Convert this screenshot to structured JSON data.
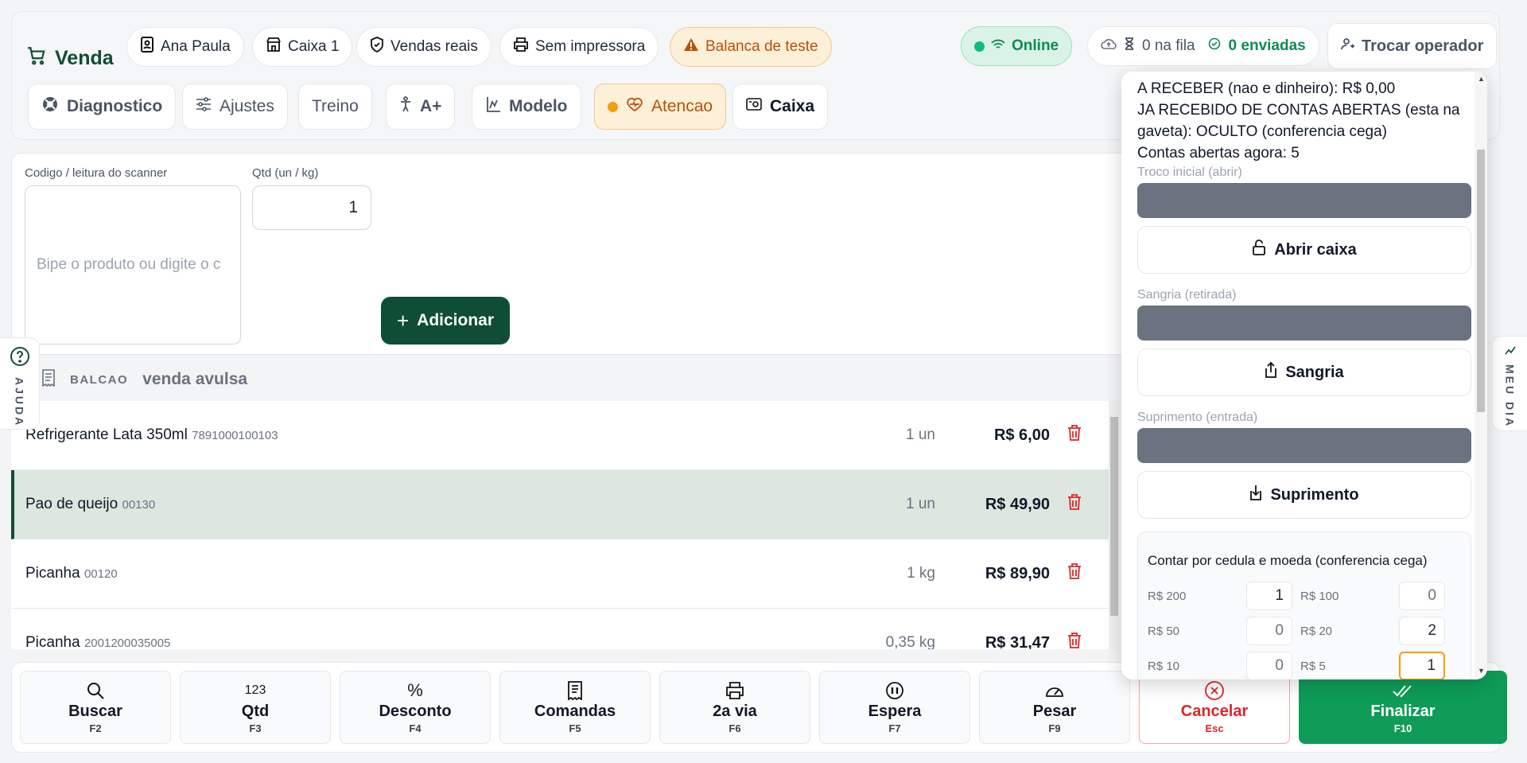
{
  "header": {
    "title": "Venda",
    "operator": "Ana Paula",
    "register": "Caixa 1",
    "mode": "Vendas reais",
    "printer": "Sem impressora",
    "scale": "Balanca de teste",
    "status": "Online",
    "queue": "0 na fila",
    "sent": "0 enviadas",
    "switch_operator": "Trocar operador"
  },
  "toolbar": {
    "diagnostics": "Diagnostico",
    "settings": "Ajustes",
    "training": "Treino",
    "font_size": "A+",
    "model": "Modelo",
    "attention": "Atencao",
    "cash": "Caixa"
  },
  "input": {
    "code_label": "Codigo / leitura do scanner",
    "code_placeholder": "Bipe o produto ou digite o c",
    "qty_label": "Qtd (un / kg)",
    "qty_value": "1",
    "add_button": "Adicionar"
  },
  "help": {
    "label": "AJUDA"
  },
  "right_tab": {
    "label": "MEU DIA"
  },
  "order": {
    "tag": "BALCAO",
    "subtitle": "venda avulsa",
    "items": [
      {
        "name": "Refrigerante Lata 350ml",
        "code": "7891000100103",
        "qty": "1 un",
        "price": "R$ 6,00"
      },
      {
        "name": "Pao de queijo",
        "code": "00130",
        "qty": "1 un",
        "price": "R$ 49,90"
      },
      {
        "name": "Picanha",
        "code": "00120",
        "qty": "1 kg",
        "price": "R$ 89,90"
      },
      {
        "name": "Picanha",
        "code": "2001200035005",
        "qty": "0,35 kg",
        "price": "R$ 31,47"
      }
    ]
  },
  "keys": [
    {
      "label": "Buscar",
      "shortcut": "F2"
    },
    {
      "label": "Qtd",
      "shortcut": "F3",
      "icon_text": "123"
    },
    {
      "label": "Desconto",
      "shortcut": "F4",
      "icon_text": "%"
    },
    {
      "label": "Comandas",
      "shortcut": "F5"
    },
    {
      "label": "2a via",
      "shortcut": "F6"
    },
    {
      "label": "Espera",
      "shortcut": "F7"
    },
    {
      "label": "Pesar",
      "shortcut": "F9"
    },
    {
      "label": "Cancelar",
      "shortcut": "Esc"
    },
    {
      "label": "Finalizar",
      "shortcut": "F10"
    }
  ],
  "cash_panel": {
    "receivable": "A RECEBER (nao e dinheiro): R$ 0,00",
    "received": "JA RECEBIDO DE CONTAS ABERTAS (esta na gaveta): OCULTO (conferencia cega)",
    "open_accounts": "Contas abertas agora: 5",
    "opening_label": "Troco inicial (abrir)",
    "open_button": "Abrir caixa",
    "withdraw_label": "Sangria (retirada)",
    "withdraw_button": "Sangria",
    "supply_label": "Suprimento (entrada)",
    "supply_button": "Suprimento",
    "count_title": "Contar por cedula e moeda (conferencia cega)",
    "denominations": [
      {
        "label": "R$ 200",
        "value": "1"
      },
      {
        "label": "R$ 100",
        "value": "0"
      },
      {
        "label": "R$ 50",
        "value": "0"
      },
      {
        "label": "R$ 20",
        "value": "2"
      },
      {
        "label": "R$ 10",
        "value": "0"
      },
      {
        "label": "R$ 5",
        "value": "1"
      }
    ]
  },
  "colors": {
    "brand": "#0f4d36",
    "accent_green": "#0e9c58",
    "warning": "#b45309",
    "danger": "#dc2626"
  }
}
